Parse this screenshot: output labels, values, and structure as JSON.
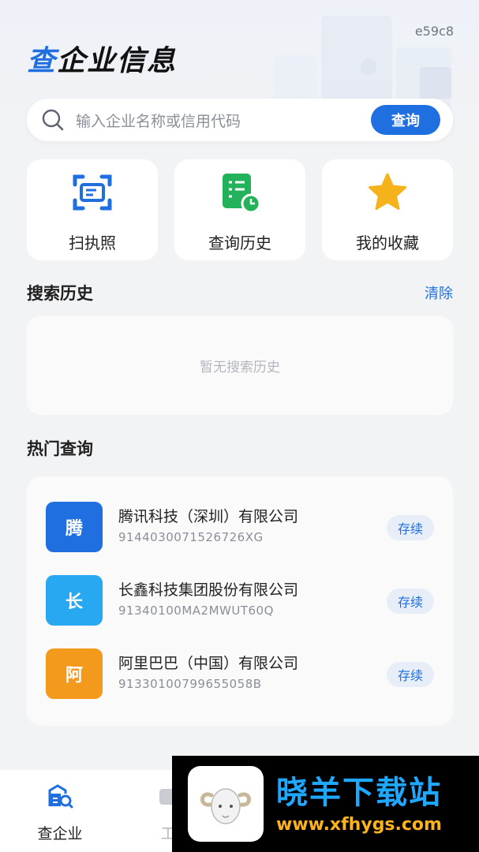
{
  "header": {
    "version": "e59c8",
    "brand_accent": "查",
    "brand_rest": "企业信息"
  },
  "search": {
    "placeholder": "输入企业名称或信用代码",
    "button_label": "查询"
  },
  "quick_actions": [
    {
      "label": "扫执照",
      "icon": "scan-license-icon"
    },
    {
      "label": "查询历史",
      "icon": "history-list-icon"
    },
    {
      "label": "我的收藏",
      "icon": "star-icon"
    }
  ],
  "search_history": {
    "title": "搜索历史",
    "clear_label": "清除",
    "empty_text": "暂无搜索历史"
  },
  "hot_queries": {
    "title": "热门查询",
    "items": [
      {
        "logo_char": "腾",
        "logo_color": "#1f6fe0",
        "name": "腾讯科技（深圳）有限公司",
        "code": "9144030071526726XG",
        "status": "存续"
      },
      {
        "logo_char": "长",
        "logo_color": "#27a8f0",
        "name": "长鑫科技集团股份有限公司",
        "code": "91340100MA2MWUT60Q",
        "status": "存续"
      },
      {
        "logo_char": "阿",
        "logo_color": "#f39a1c",
        "name": "阿里巴巴（中国）有限公司",
        "code": "91330100799655058B",
        "status": "存续"
      }
    ]
  },
  "tabbar": {
    "tabs": [
      {
        "label": "查企业",
        "icon": "company-search-icon",
        "active": true
      },
      {
        "label": "工",
        "icon": "tools-icon",
        "active": false
      }
    ]
  },
  "watermark": {
    "title": "晓羊下载站",
    "url": "www.xfhygs.com"
  },
  "colors": {
    "accent": "#1f6fe0",
    "background": "#f2f3f5",
    "status_bg": "#e8eef8"
  }
}
